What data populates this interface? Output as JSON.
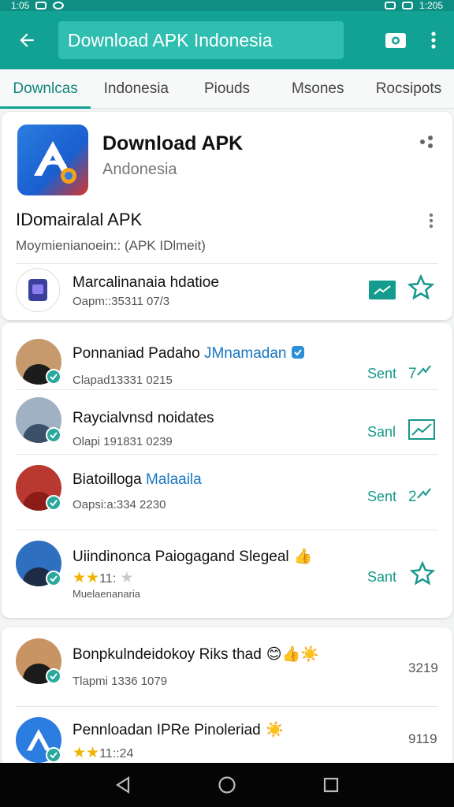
{
  "status_bar": {
    "time_left": "1:05",
    "time_right": "1:205"
  },
  "app_bar": {
    "search_value": "Download APK Indonesia"
  },
  "tabs": [
    {
      "label": "Downlcas"
    },
    {
      "label": "Indonesia"
    },
    {
      "label": "Piouds"
    },
    {
      "label": "Msones"
    },
    {
      "label": "Rocsipots"
    }
  ],
  "app_card": {
    "title": "Download APK",
    "subtitle": "Andonesia",
    "section_title": "IDomairalal APK",
    "section_subtitle": "Moymienianoein::  (APK IDlmeit)",
    "developer": {
      "name": "Marcalinanaia hdatioe",
      "meta": "Oapm::35311     07/3"
    }
  },
  "list": [
    {
      "title": "Ponnaniad Padaho",
      "accent": "JMnamadan",
      "meta": "Clapad13331     0215",
      "status": "Sent",
      "action": "7"
    },
    {
      "title": "Raycialvnsd noidates",
      "accent": "",
      "meta": "Olapi 191831     0239",
      "status": "Sanl",
      "action": ""
    },
    {
      "title": "Biatoilloga",
      "accent": "Malaaila",
      "meta": "Oapsi:a:334     2230",
      "status": "Sent",
      "action": "2"
    },
    {
      "title": "Uiindinonca Paiogagand Slegeal",
      "accent": "",
      "rating_text": "11:",
      "meta": "Muelaenanaria",
      "status": "Sant",
      "action": ""
    }
  ],
  "list2": [
    {
      "title": "Bonpkulndeidokoy Riks thad",
      "meta": "Tlapmi 1336     1079",
      "number": "3219"
    },
    {
      "title": "Pennloadan IPRe Pinoleriad",
      "rating_text": "11::24",
      "number": "9119"
    }
  ],
  "colors": {
    "primary": "#12a293",
    "primary_dark": "#0f8f83",
    "accent_text": "#16988a",
    "link_blue": "#1976c0",
    "star": "#f0b400"
  }
}
